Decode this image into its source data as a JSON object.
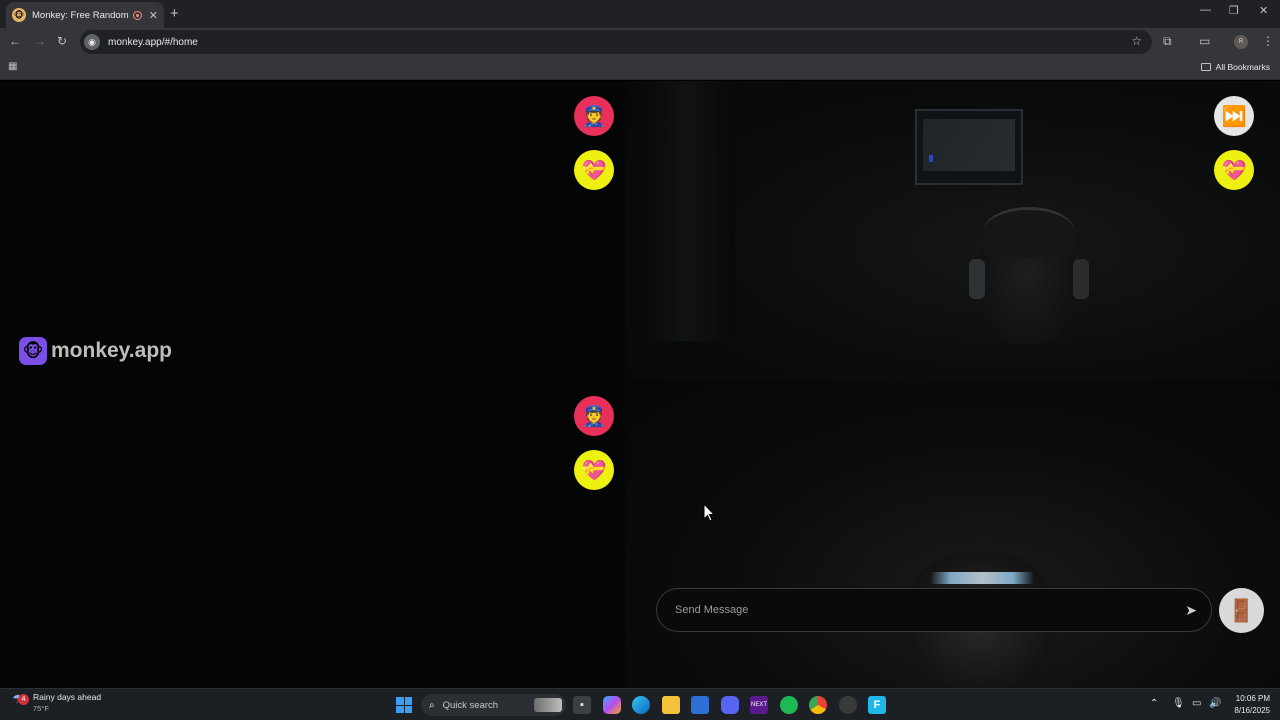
{
  "browser": {
    "tab_title": "Monkey: Free Random Vide",
    "tab_close": "✕",
    "new_tab": "+",
    "url": "monkey.app/#/home",
    "bookmarks_label": "All Bookmarks",
    "profile_initial": "R"
  },
  "page": {
    "brand_name": "monkey.app",
    "message_placeholder": "Send Message",
    "reaction_icons": [
      "police-officer",
      "heart-with-ribbon",
      "next-track",
      "door-exit"
    ]
  },
  "taskbar": {
    "weather_text": "Rainy days ahead",
    "weather_temp": "75°F",
    "weather_badge": "4",
    "search_label": "Quick search",
    "time": "10:06 PM",
    "date": "8/16/2025"
  },
  "colors": {
    "report_red": "#e9305a",
    "like_yellow": "#eef011",
    "brand_purple": "#7b4ee8"
  }
}
